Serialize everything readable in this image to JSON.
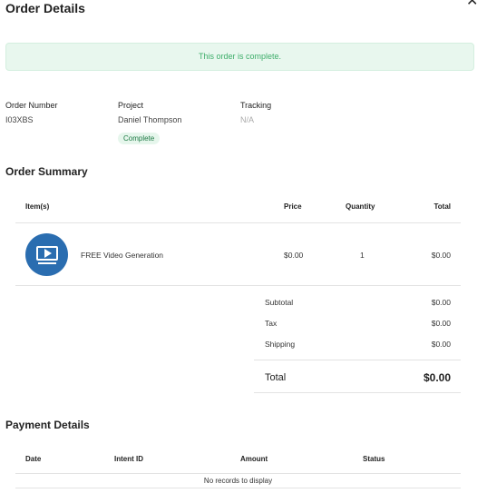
{
  "header": {
    "title": "Order Details",
    "close_glyph": "✕"
  },
  "alert": {
    "message": "This order is complete."
  },
  "meta": {
    "order_number_label": "Order Number",
    "order_number_value": "I03XBS",
    "project_label": "Project",
    "project_value": "Daniel Thompson",
    "status_badge": "Complete",
    "tracking_label": "Tracking",
    "tracking_value": "N/A"
  },
  "order_summary": {
    "heading": "Order Summary",
    "columns": {
      "items": "Item(s)",
      "price": "Price",
      "quantity": "Quantity",
      "total": "Total"
    },
    "rows": [
      {
        "icon": "video-monitor-icon",
        "name": "FREE Video Generation",
        "price": "$0.00",
        "quantity": "1",
        "total": "$0.00"
      }
    ],
    "subtotal_label": "Subtotal",
    "subtotal_value": "$0.00",
    "tax_label": "Tax",
    "tax_value": "$0.00",
    "shipping_label": "Shipping",
    "shipping_value": "$0.00",
    "total_label": "Total",
    "total_value": "$0.00"
  },
  "payment_details": {
    "heading": "Payment Details",
    "columns": {
      "date": "Date",
      "intent_id": "Intent ID",
      "amount": "Amount",
      "status": "Status"
    },
    "empty_message": "No records to display"
  },
  "colors": {
    "alert_bg": "#e8f7ee",
    "alert_text": "#3fae6b",
    "badge_bg": "#e6f6ec",
    "badge_text": "#1e7a45",
    "icon_bg": "#2a6db0"
  }
}
